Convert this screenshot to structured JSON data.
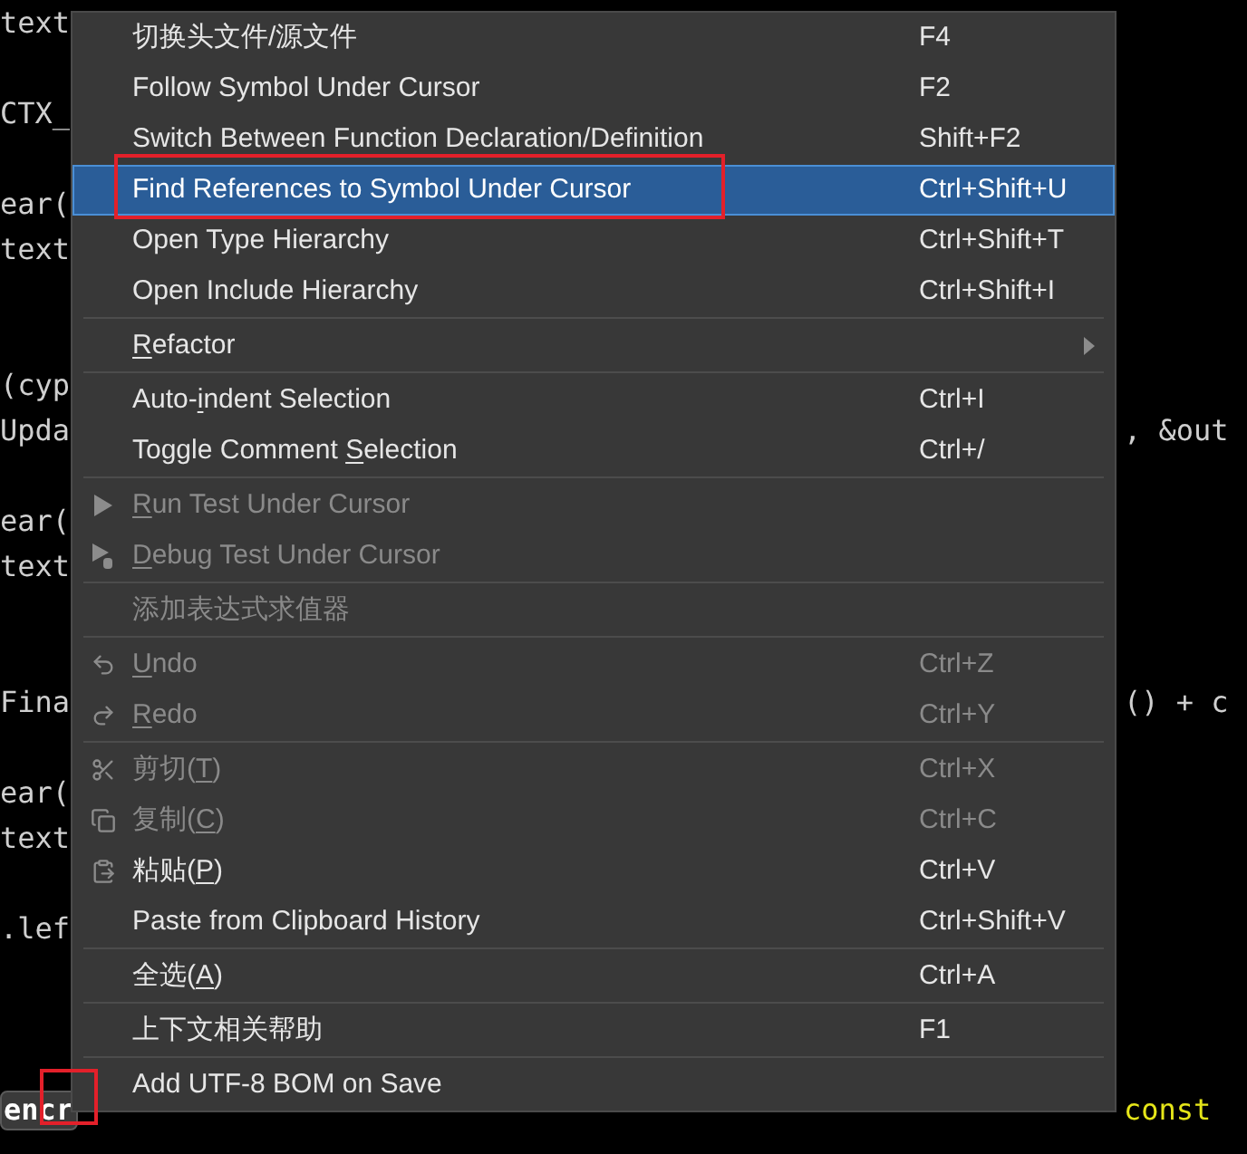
{
  "code_lines": [
    {
      "kind": "code",
      "left": "text"
    },
    {
      "kind": "blank"
    },
    {
      "kind": "code",
      "left": "CTX_"
    },
    {
      "kind": "blank"
    },
    {
      "kind": "code",
      "left": "ear("
    },
    {
      "kind": "code",
      "left": "text"
    },
    {
      "kind": "blank"
    },
    {
      "kind": "blank"
    },
    {
      "kind": "code",
      "left": "(cyp"
    },
    {
      "kind": "code",
      "left": "Upda",
      "right": {
        "text": ", &out",
        "color": "#cfcfcf"
      }
    },
    {
      "kind": "blank"
    },
    {
      "kind": "code",
      "left": "ear("
    },
    {
      "kind": "code",
      "left": "text"
    },
    {
      "kind": "blank"
    },
    {
      "kind": "blank"
    },
    {
      "kind": "code",
      "left": "Fina",
      "right": {
        "text": "() + c",
        "color": "#cfcfcf"
      }
    },
    {
      "kind": "blank"
    },
    {
      "kind": "code",
      "left": "ear("
    },
    {
      "kind": "code",
      "left": "text"
    },
    {
      "kind": "blank"
    },
    {
      "kind": "code",
      "left": ".lef"
    },
    {
      "kind": "blank"
    },
    {
      "kind": "blank"
    },
    {
      "kind": "blank"
    },
    {
      "kind": "code",
      "left": "encr",
      "left_highlighted": true,
      "right": {
        "text": "const",
        "color": "#e6e619"
      }
    }
  ],
  "context_menu": {
    "items": [
      {
        "kind": "item",
        "label": {
          "pre": "切换头文件/源文件"
        },
        "shortcut": "F4",
        "disabled": false,
        "selected": false
      },
      {
        "kind": "item",
        "label": {
          "pre": "Follow Symbol Under Cursor"
        },
        "shortcut": "F2",
        "disabled": false,
        "selected": false
      },
      {
        "kind": "item",
        "label": {
          "pre": "Switch Between Function Declaration/Definition"
        },
        "shortcut": "Shift+F2",
        "disabled": false,
        "selected": false
      },
      {
        "kind": "item",
        "label": {
          "pre": "Find References to Symbol Under Cursor"
        },
        "shortcut": "Ctrl+Shift+U",
        "disabled": false,
        "selected": true
      },
      {
        "kind": "item",
        "label": {
          "pre": "Open Type Hierarchy"
        },
        "shortcut": "Ctrl+Shift+T",
        "disabled": false,
        "selected": false
      },
      {
        "kind": "item",
        "label": {
          "pre": "Open Include Hierarchy"
        },
        "shortcut": "Ctrl+Shift+I",
        "disabled": false,
        "selected": false
      },
      {
        "kind": "separator"
      },
      {
        "kind": "item",
        "label": {
          "key": "R",
          "post": "efactor"
        },
        "submenu": true,
        "disabled": false,
        "selected": false
      },
      {
        "kind": "separator"
      },
      {
        "kind": "item",
        "label": {
          "pre": "Auto-",
          "key": "i",
          "post": "ndent Selection"
        },
        "shortcut": "Ctrl+I",
        "disabled": false,
        "selected": false
      },
      {
        "kind": "item",
        "label": {
          "pre": "Toggle Comment ",
          "key": "S",
          "post": "election"
        },
        "shortcut": "Ctrl+/",
        "disabled": false,
        "selected": false
      },
      {
        "kind": "separator"
      },
      {
        "kind": "item",
        "label": {
          "key": "R",
          "post": "un Test Under Cursor"
        },
        "disabled": true,
        "selected": false
      },
      {
        "kind": "item",
        "label": {
          "key": "D",
          "post": "ebug Test Under Cursor"
        },
        "disabled": true,
        "selected": false
      },
      {
        "kind": "separator"
      },
      {
        "kind": "item",
        "label": {
          "pre": "添加表达式求值器"
        },
        "disabled": true,
        "selected": false
      },
      {
        "kind": "separator"
      },
      {
        "kind": "item",
        "label": {
          "key": "U",
          "post": "ndo"
        },
        "shortcut": "Ctrl+Z",
        "disabled": true,
        "selected": false
      },
      {
        "kind": "item",
        "label": {
          "key": "R",
          "post": "edo"
        },
        "shortcut": "Ctrl+Y",
        "disabled": true,
        "selected": false
      },
      {
        "kind": "separator"
      },
      {
        "kind": "item",
        "label": {
          "pre": "剪切(",
          "key": "T",
          "post": ")"
        },
        "shortcut": "Ctrl+X",
        "disabled": true,
        "selected": false
      },
      {
        "kind": "item",
        "label": {
          "pre": "复制(",
          "key": "C",
          "post": ")"
        },
        "shortcut": "Ctrl+C",
        "disabled": true,
        "selected": false
      },
      {
        "kind": "item",
        "label": {
          "pre": "粘贴(",
          "key": "P",
          "post": ")"
        },
        "shortcut": "Ctrl+V",
        "disabled": false,
        "selected": false
      },
      {
        "kind": "item",
        "label": {
          "pre": "Paste from Clipboard History"
        },
        "shortcut": "Ctrl+Shift+V",
        "disabled": false,
        "selected": false
      },
      {
        "kind": "separator"
      },
      {
        "kind": "item",
        "label": {
          "pre": "全选(",
          "key": "A",
          "post": ")"
        },
        "shortcut": "Ctrl+A",
        "disabled": false,
        "selected": false
      },
      {
        "kind": "separator"
      },
      {
        "kind": "item",
        "label": {
          "pre": "上下文相关帮助"
        },
        "shortcut": "F1",
        "disabled": false,
        "selected": false
      },
      {
        "kind": "separator"
      },
      {
        "kind": "item",
        "label": {
          "pre": "Add UTF-8 BOM on Save"
        },
        "disabled": false,
        "selected": false
      }
    ]
  }
}
